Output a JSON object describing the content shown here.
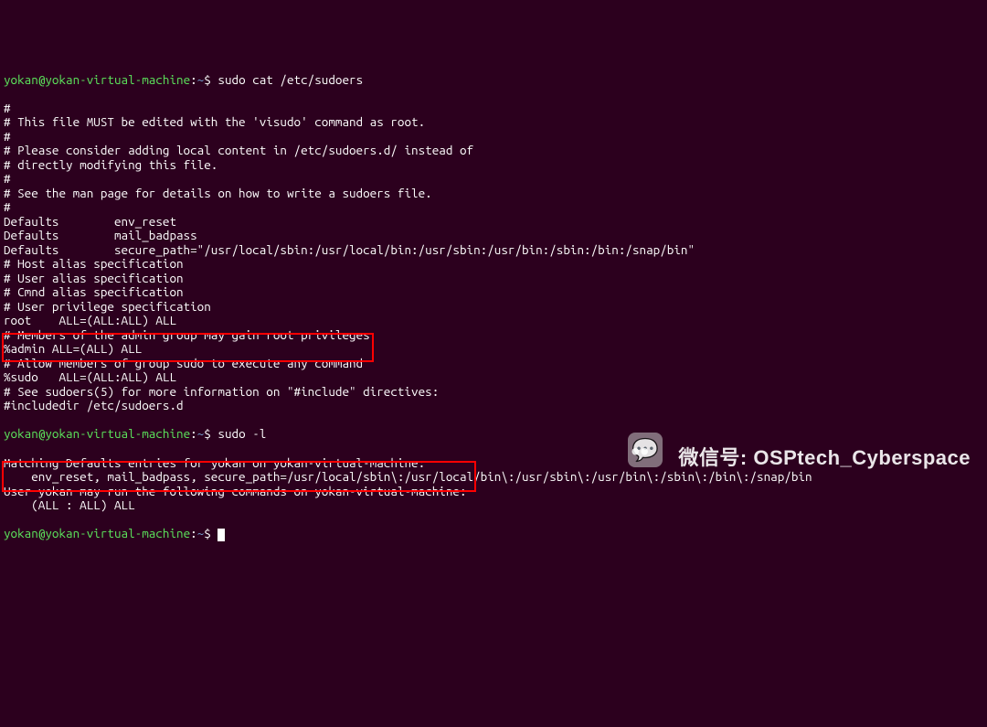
{
  "prompt": {
    "user": "yokan",
    "host": "yokan-virtual-machine",
    "path": "~",
    "symbol": "$"
  },
  "cmd1": "sudo cat /etc/sudoers",
  "sudoers": [
    "#",
    "# This file MUST be edited with the 'visudo' command as root.",
    "#",
    "# Please consider adding local content in /etc/sudoers.d/ instead of",
    "# directly modifying this file.",
    "#",
    "# See the man page for details on how to write a sudoers file.",
    "#",
    "Defaults        env_reset",
    "Defaults        mail_badpass",
    "Defaults        secure_path=\"/usr/local/sbin:/usr/local/bin:/usr/sbin:/usr/bin:/sbin:/bin:/snap/bin\"",
    "",
    "# Host alias specification",
    "",
    "# User alias specification",
    "",
    "# Cmnd alias specification",
    "",
    "# User privilege specification",
    "root    ALL=(ALL:ALL) ALL",
    "",
    "# Members of the admin group may gain root privileges",
    "%admin ALL=(ALL) ALL",
    "",
    "# Allow members of group sudo to execute any command",
    "%sudo   ALL=(ALL:ALL) ALL",
    "",
    "# See sudoers(5) for more information on \"#include\" directives:",
    "",
    "#includedir /etc/sudoers.d"
  ],
  "cmd2": "sudo -l",
  "sudo_l": [
    "Matching Defaults entries for yokan on yokan-virtual-machine:",
    "    env_reset, mail_badpass, secure_path=/usr/local/sbin\\:/usr/local/bin\\:/usr/sbin\\:/usr/bin\\:/sbin\\:/bin\\:/snap/bin",
    "",
    "User yokan may run the following commands on yokan-virtual-machine:",
    "    (ALL : ALL) ALL"
  ],
  "watermark": {
    "label": "微信号:",
    "handle": "OSPtech_Cyberspace"
  }
}
